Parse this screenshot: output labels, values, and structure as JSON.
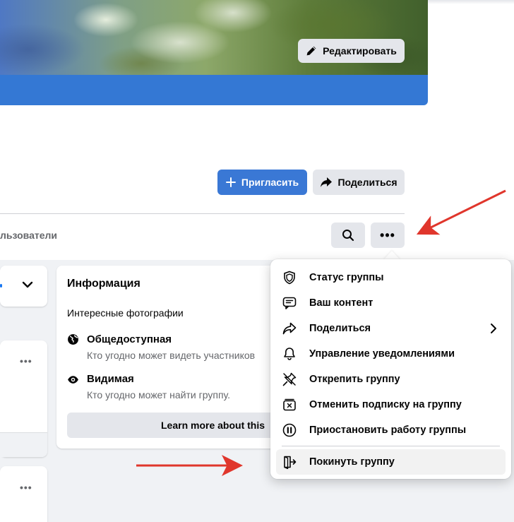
{
  "header": {
    "edit_cover_label": "Редактировать",
    "invite_label": "Пригласить",
    "share_label": "Поделиться"
  },
  "tabs": {
    "users_partial_label": "льзователи"
  },
  "info_card": {
    "title": "Информация",
    "description": "Интересные фотографии",
    "privacy": {
      "title": "Общедоступная",
      "subtitle": "Кто угодно может видеть участников"
    },
    "visibility": {
      "title": "Видимая",
      "subtitle": "Кто угодно может найти группу."
    },
    "learn_more_label": "Learn more about this"
  },
  "menu": {
    "items": [
      {
        "label": "Статус группы",
        "icon": "shield-icon"
      },
      {
        "label": "Ваш контент",
        "icon": "content-icon"
      },
      {
        "label": "Поделиться",
        "icon": "share-icon",
        "has_submenu": true
      },
      {
        "label": "Управление уведомлениями",
        "icon": "bell-icon"
      },
      {
        "label": "Открепить группу",
        "icon": "unpin-icon"
      },
      {
        "label": "Отменить подписку на группу",
        "icon": "unfollow-icon"
      },
      {
        "label": "Приостановить работу группы",
        "icon": "pause-icon"
      },
      {
        "label": "Покинуть группу",
        "icon": "leave-icon",
        "highlighted": true
      }
    ]
  },
  "colors": {
    "accent": "#3a78d5",
    "cover_strip": "#3478d4",
    "annotation_arrow": "#e0362c",
    "page_background": "#f0f2f5"
  }
}
